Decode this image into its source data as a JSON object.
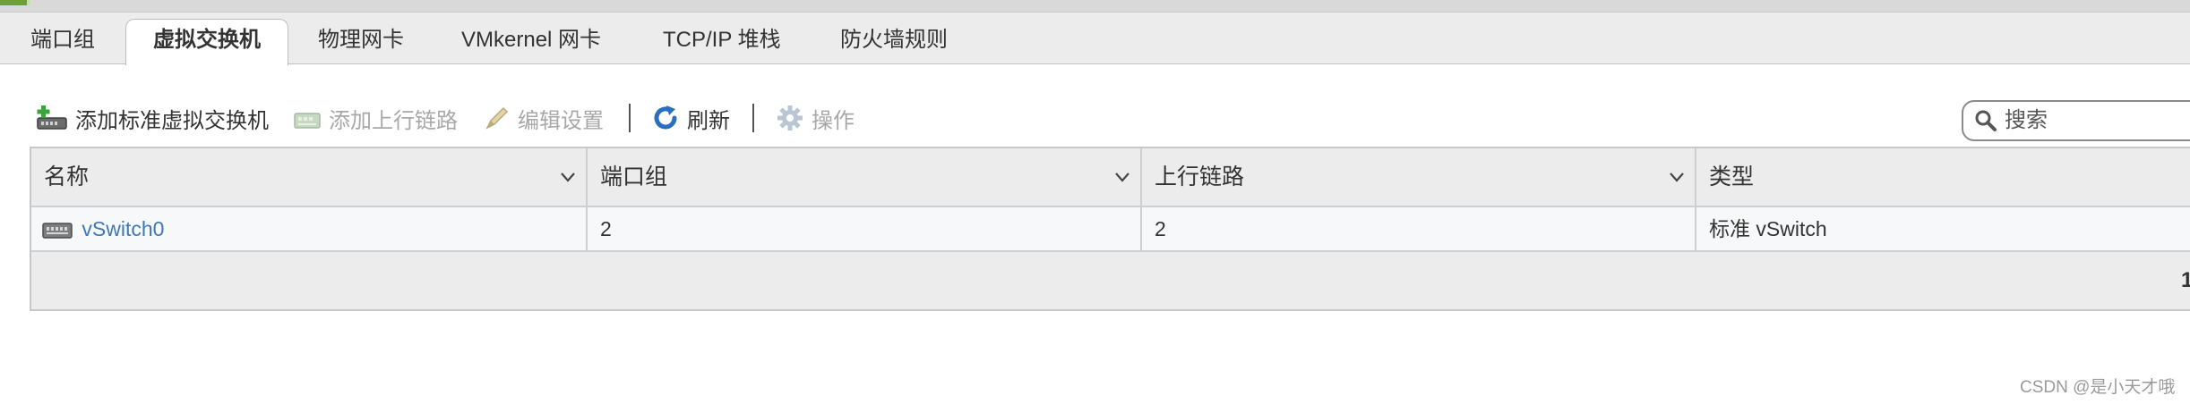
{
  "tabs": [
    {
      "label": "端口组",
      "active": false
    },
    {
      "label": "虚拟交换机",
      "active": true
    },
    {
      "label": "物理网卡",
      "active": false
    },
    {
      "label": "VMkernel 网卡",
      "active": false
    },
    {
      "label": "TCP/IP 堆栈",
      "active": false
    },
    {
      "label": "防火墙规则",
      "active": false
    }
  ],
  "toolbar": {
    "add_standard_vswitch": "添加标准虚拟交换机",
    "add_uplink": "添加上行链路",
    "edit_settings": "编辑设置",
    "refresh": "刷新",
    "actions": "操作",
    "search_placeholder": "搜索"
  },
  "table": {
    "columns": [
      "名称",
      "端口组",
      "上行链路",
      "类型"
    ],
    "rows": [
      {
        "name": "vSwitch0",
        "port_groups": "2",
        "uplinks": "2",
        "type": "标准 vSwitch"
      }
    ],
    "footer_count": "1"
  },
  "watermark": "CSDN @是小天才哦",
  "colors": {
    "link": "#3f78b5",
    "disabled": "#a8a8a8",
    "refresh_icon": "#2a6fbf"
  }
}
